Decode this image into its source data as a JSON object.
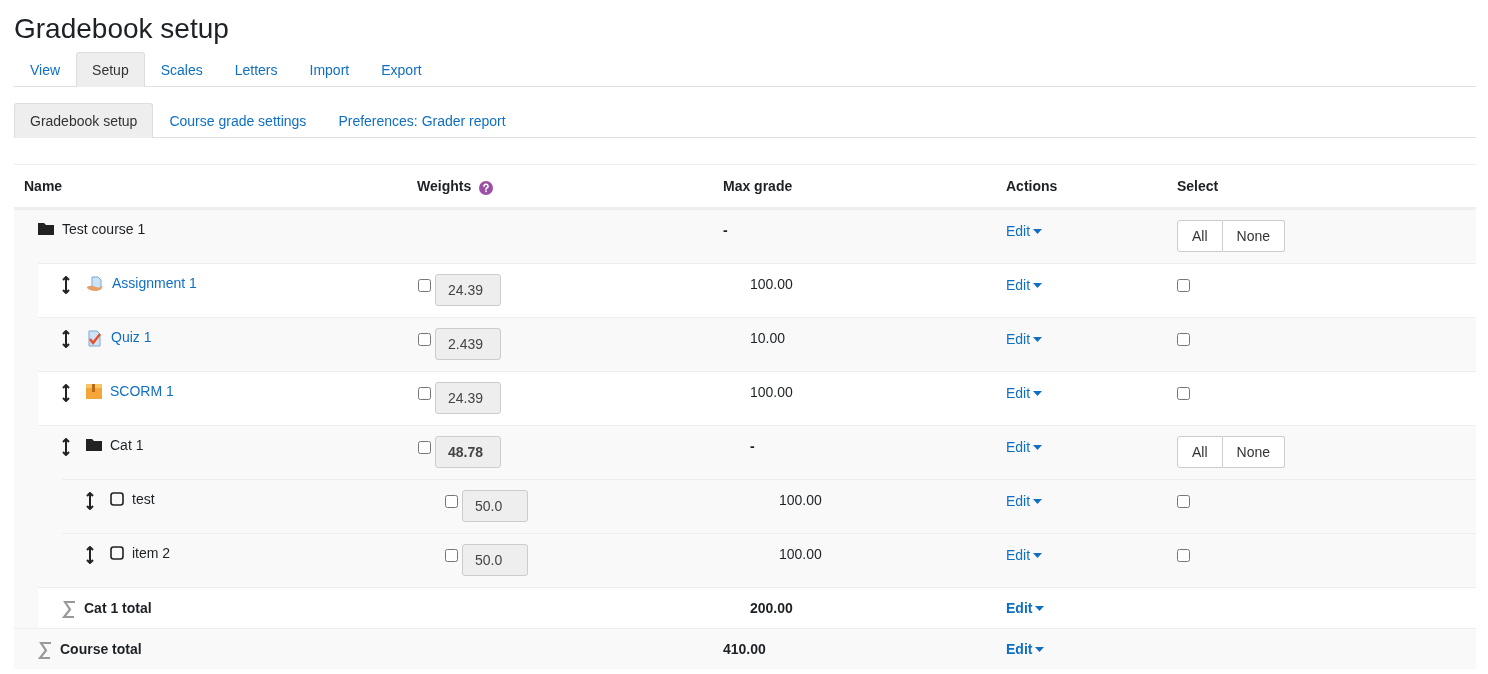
{
  "title": "Gradebook setup",
  "tabs": [
    {
      "label": "View",
      "selected": false
    },
    {
      "label": "Setup",
      "selected": true
    },
    {
      "label": "Scales",
      "selected": false
    },
    {
      "label": "Letters",
      "selected": false
    },
    {
      "label": "Import",
      "selected": false
    },
    {
      "label": "Export",
      "selected": false
    }
  ],
  "subtabs": [
    {
      "label": "Gradebook setup",
      "selected": true
    },
    {
      "label": "Course grade settings",
      "selected": false
    },
    {
      "label": "Preferences: Grader report",
      "selected": false
    }
  ],
  "table": {
    "columns": [
      "Name",
      "Weights",
      "Max grade",
      "Actions",
      "Select"
    ],
    "rows": [
      {
        "kind": "category",
        "name": "Test course 1",
        "max_grade": "-",
        "action": "Edit",
        "select_all": "All",
        "select_none": "None",
        "children": [
          {
            "kind": "assignment",
            "name": "Assignment 1",
            "weight": {
              "value": "24.39",
              "checked": false
            },
            "max_grade": "100.00",
            "action": "Edit",
            "checked": false
          },
          {
            "kind": "quiz",
            "name": "Quiz 1",
            "weight": {
              "value": "2.439",
              "checked": false
            },
            "max_grade": "10.00",
            "action": "Edit",
            "checked": false
          },
          {
            "kind": "scorm",
            "name": "SCORM 1",
            "weight": {
              "value": "24.39",
              "checked": false
            },
            "max_grade": "100.00",
            "action": "Edit",
            "checked": false
          },
          {
            "kind": "category",
            "name": "Cat 1",
            "weight": {
              "value": "48.78",
              "checked": false
            },
            "max_grade": "-",
            "action": "Edit",
            "select_all": "All",
            "select_none": "None",
            "children": [
              {
                "kind": "manual",
                "name": "test",
                "weight": {
                  "value": "50.0",
                  "checked": false
                },
                "max_grade": "100.00",
                "action": "Edit",
                "checked": false
              },
              {
                "kind": "manual",
                "name": "item 2",
                "weight": {
                  "value": "50.0",
                  "checked": false
                },
                "max_grade": "100.00",
                "action": "Edit",
                "checked": false
              },
              {
                "kind": "total",
                "name": "Cat 1 total",
                "max_grade": "200.00",
                "action": "Edit"
              }
            ]
          },
          {
            "kind": "total",
            "name": "Course total",
            "max_grade": "410.00",
            "action": "Edit"
          }
        ]
      }
    ]
  }
}
